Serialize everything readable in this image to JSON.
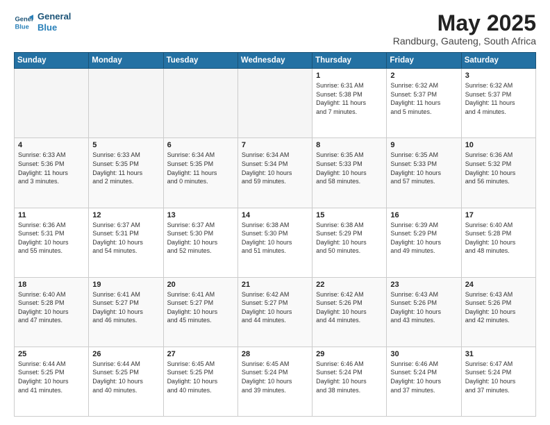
{
  "header": {
    "logo_line1": "General",
    "logo_line2": "Blue",
    "title": "May 2025",
    "subtitle": "Randburg, Gauteng, South Africa"
  },
  "weekdays": [
    "Sunday",
    "Monday",
    "Tuesday",
    "Wednesday",
    "Thursday",
    "Friday",
    "Saturday"
  ],
  "rows": [
    [
      {
        "day": "",
        "info": ""
      },
      {
        "day": "",
        "info": ""
      },
      {
        "day": "",
        "info": ""
      },
      {
        "day": "",
        "info": ""
      },
      {
        "day": "1",
        "info": "Sunrise: 6:31 AM\nSunset: 5:38 PM\nDaylight: 11 hours\nand 7 minutes."
      },
      {
        "day": "2",
        "info": "Sunrise: 6:32 AM\nSunset: 5:37 PM\nDaylight: 11 hours\nand 5 minutes."
      },
      {
        "day": "3",
        "info": "Sunrise: 6:32 AM\nSunset: 5:37 PM\nDaylight: 11 hours\nand 4 minutes."
      }
    ],
    [
      {
        "day": "4",
        "info": "Sunrise: 6:33 AM\nSunset: 5:36 PM\nDaylight: 11 hours\nand 3 minutes."
      },
      {
        "day": "5",
        "info": "Sunrise: 6:33 AM\nSunset: 5:35 PM\nDaylight: 11 hours\nand 2 minutes."
      },
      {
        "day": "6",
        "info": "Sunrise: 6:34 AM\nSunset: 5:35 PM\nDaylight: 11 hours\nand 0 minutes."
      },
      {
        "day": "7",
        "info": "Sunrise: 6:34 AM\nSunset: 5:34 PM\nDaylight: 10 hours\nand 59 minutes."
      },
      {
        "day": "8",
        "info": "Sunrise: 6:35 AM\nSunset: 5:33 PM\nDaylight: 10 hours\nand 58 minutes."
      },
      {
        "day": "9",
        "info": "Sunrise: 6:35 AM\nSunset: 5:33 PM\nDaylight: 10 hours\nand 57 minutes."
      },
      {
        "day": "10",
        "info": "Sunrise: 6:36 AM\nSunset: 5:32 PM\nDaylight: 10 hours\nand 56 minutes."
      }
    ],
    [
      {
        "day": "11",
        "info": "Sunrise: 6:36 AM\nSunset: 5:31 PM\nDaylight: 10 hours\nand 55 minutes."
      },
      {
        "day": "12",
        "info": "Sunrise: 6:37 AM\nSunset: 5:31 PM\nDaylight: 10 hours\nand 54 minutes."
      },
      {
        "day": "13",
        "info": "Sunrise: 6:37 AM\nSunset: 5:30 PM\nDaylight: 10 hours\nand 52 minutes."
      },
      {
        "day": "14",
        "info": "Sunrise: 6:38 AM\nSunset: 5:30 PM\nDaylight: 10 hours\nand 51 minutes."
      },
      {
        "day": "15",
        "info": "Sunrise: 6:38 AM\nSunset: 5:29 PM\nDaylight: 10 hours\nand 50 minutes."
      },
      {
        "day": "16",
        "info": "Sunrise: 6:39 AM\nSunset: 5:29 PM\nDaylight: 10 hours\nand 49 minutes."
      },
      {
        "day": "17",
        "info": "Sunrise: 6:40 AM\nSunset: 5:28 PM\nDaylight: 10 hours\nand 48 minutes."
      }
    ],
    [
      {
        "day": "18",
        "info": "Sunrise: 6:40 AM\nSunset: 5:28 PM\nDaylight: 10 hours\nand 47 minutes."
      },
      {
        "day": "19",
        "info": "Sunrise: 6:41 AM\nSunset: 5:27 PM\nDaylight: 10 hours\nand 46 minutes."
      },
      {
        "day": "20",
        "info": "Sunrise: 6:41 AM\nSunset: 5:27 PM\nDaylight: 10 hours\nand 45 minutes."
      },
      {
        "day": "21",
        "info": "Sunrise: 6:42 AM\nSunset: 5:27 PM\nDaylight: 10 hours\nand 44 minutes."
      },
      {
        "day": "22",
        "info": "Sunrise: 6:42 AM\nSunset: 5:26 PM\nDaylight: 10 hours\nand 44 minutes."
      },
      {
        "day": "23",
        "info": "Sunrise: 6:43 AM\nSunset: 5:26 PM\nDaylight: 10 hours\nand 43 minutes."
      },
      {
        "day": "24",
        "info": "Sunrise: 6:43 AM\nSunset: 5:26 PM\nDaylight: 10 hours\nand 42 minutes."
      }
    ],
    [
      {
        "day": "25",
        "info": "Sunrise: 6:44 AM\nSunset: 5:25 PM\nDaylight: 10 hours\nand 41 minutes."
      },
      {
        "day": "26",
        "info": "Sunrise: 6:44 AM\nSunset: 5:25 PM\nDaylight: 10 hours\nand 40 minutes."
      },
      {
        "day": "27",
        "info": "Sunrise: 6:45 AM\nSunset: 5:25 PM\nDaylight: 10 hours\nand 40 minutes."
      },
      {
        "day": "28",
        "info": "Sunrise: 6:45 AM\nSunset: 5:24 PM\nDaylight: 10 hours\nand 39 minutes."
      },
      {
        "day": "29",
        "info": "Sunrise: 6:46 AM\nSunset: 5:24 PM\nDaylight: 10 hours\nand 38 minutes."
      },
      {
        "day": "30",
        "info": "Sunrise: 6:46 AM\nSunset: 5:24 PM\nDaylight: 10 hours\nand 37 minutes."
      },
      {
        "day": "31",
        "info": "Sunrise: 6:47 AM\nSunset: 5:24 PM\nDaylight: 10 hours\nand 37 minutes."
      }
    ]
  ]
}
